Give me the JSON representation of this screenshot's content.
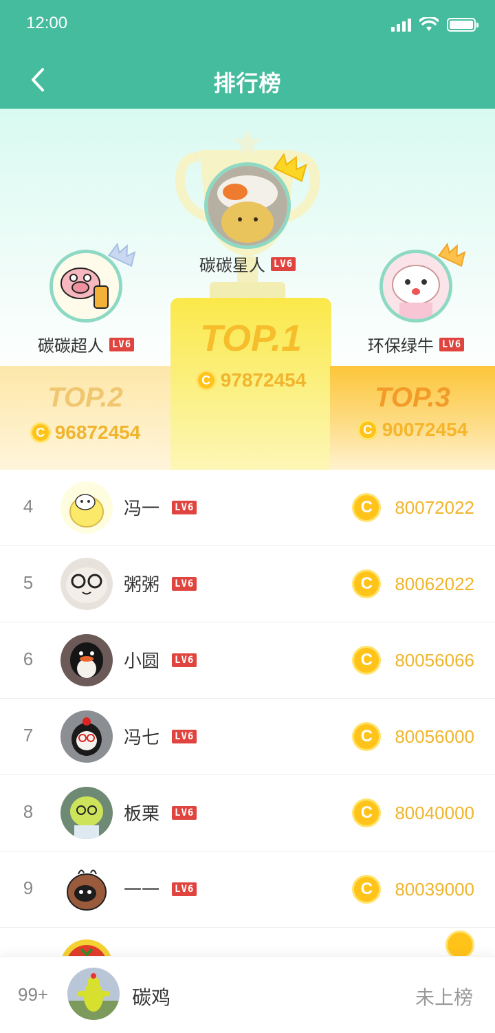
{
  "status_bar": {
    "time": "12:00"
  },
  "header": {
    "title": "排行榜"
  },
  "podium": {
    "first": {
      "name": "碳碳星人",
      "level": "LV6",
      "top_label": "TOP.1",
      "score": "97872454"
    },
    "second": {
      "name": "碳碳超人",
      "level": "LV6",
      "top_label": "TOP.2",
      "score": "96872454"
    },
    "third": {
      "name": "环保绿牛",
      "level": "LV6",
      "top_label": "TOP.3",
      "score": "90072454"
    }
  },
  "coin_symbol": "C",
  "list": [
    {
      "rank": "4",
      "name": "冯一",
      "level": "LV6",
      "score": "80072022"
    },
    {
      "rank": "5",
      "name": "粥粥",
      "level": "LV6",
      "score": "80062022"
    },
    {
      "rank": "6",
      "name": "小圆",
      "level": "LV6",
      "score": "80056066"
    },
    {
      "rank": "7",
      "name": "冯七",
      "level": "LV6",
      "score": "80056000"
    },
    {
      "rank": "8",
      "name": "板栗",
      "level": "LV6",
      "score": "80040000"
    },
    {
      "rank": "9",
      "name": "一一",
      "level": "LV6",
      "score": "80039000"
    }
  ],
  "me": {
    "rank": "99+",
    "name": "碳鸡",
    "status": "未上榜"
  },
  "colors": {
    "header": "#45bc9e",
    "accent_gold": "#f0b52d",
    "level_badge": "#e0443e"
  }
}
